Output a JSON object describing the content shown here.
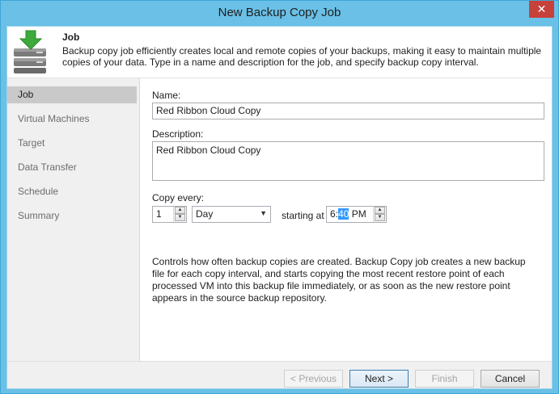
{
  "window": {
    "title": "New Backup Copy Job",
    "close_glyph": "✕"
  },
  "header": {
    "title": "Job",
    "description": "Backup copy job efficiently creates local and remote copies of your backups, making it easy to maintain multiple copies of your data. Type in a name and description for the job, and specify backup copy interval.",
    "icon": "server-download-icon"
  },
  "nav": {
    "items": [
      {
        "label": "Job",
        "active": true
      },
      {
        "label": "Virtual Machines",
        "active": false
      },
      {
        "label": "Target",
        "active": false
      },
      {
        "label": "Data Transfer",
        "active": false
      },
      {
        "label": "Schedule",
        "active": false
      },
      {
        "label": "Summary",
        "active": false
      }
    ]
  },
  "form": {
    "name_label": "Name:",
    "name_value": "Red Ribbon Cloud Copy",
    "description_label": "Description:",
    "description_value": "Red Ribbon Cloud Copy",
    "copy_every_label": "Copy every:",
    "interval_value": "1",
    "interval_unit": "Day",
    "starting_at_label": "starting at",
    "time_hour": "6:",
    "time_minute": "40",
    "time_ampm": " PM",
    "help_text": "Controls how often backup copies are created. Backup Copy job creates a new backup file for each copy interval, and starts copying the most recent restore point of each processed VM into this backup file immediately, or as soon as the new restore point appears in the source backup repository."
  },
  "footer": {
    "previous_label": "< Previous",
    "next_label": "Next >",
    "finish_label": "Finish",
    "cancel_label": "Cancel"
  }
}
